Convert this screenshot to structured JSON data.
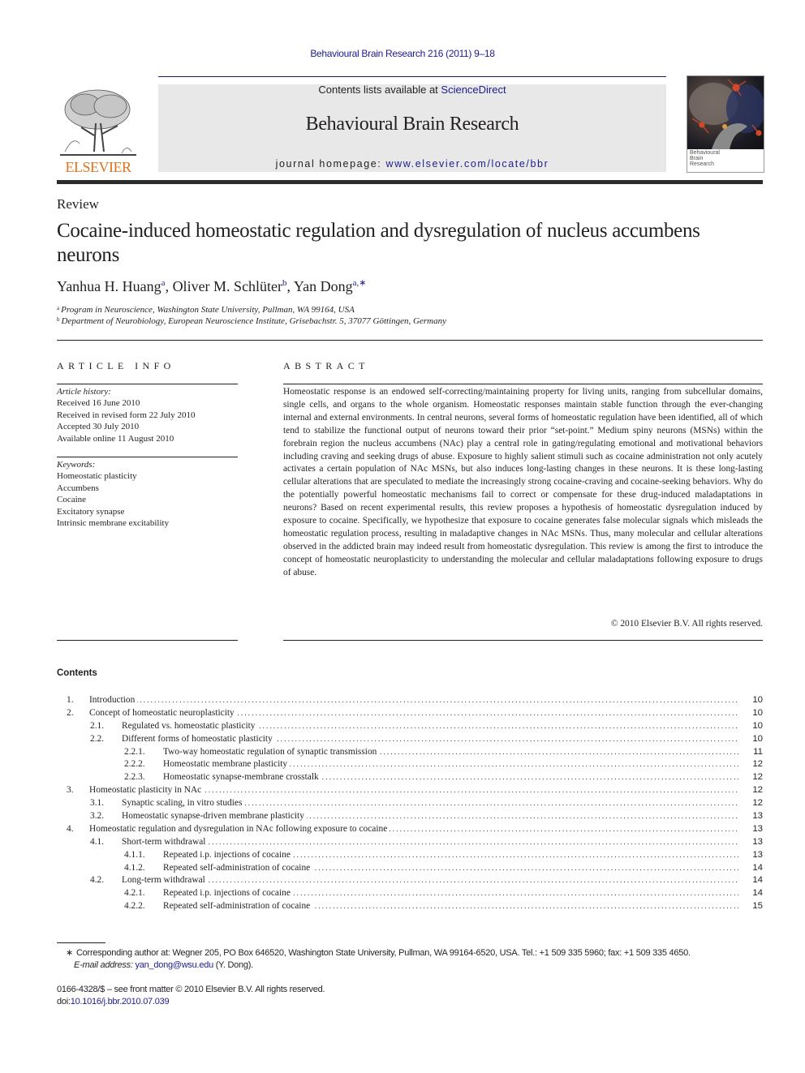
{
  "header": {
    "journal_citation": "Behavioural Brain Research 216 (2011) 9–18",
    "contents_prefix": "Contents lists available at ",
    "contents_link": "ScienceDirect",
    "journal_name": "Behavioural Brain Research",
    "homepage_prefix": "journal homepage: ",
    "homepage_link": "www.elsevier.com/locate/bbr",
    "publisher_logo_text": "ELSEVIER",
    "cover_title_lines": [
      "Behavioural",
      "Brain",
      "Research"
    ],
    "colors": {
      "link": "#1c1c8e",
      "elsevier_orange": "#e1711f",
      "masthead_gray": "#e8e8e8"
    }
  },
  "article": {
    "type": "Review",
    "title": "Cocaine-induced homeostatic regulation and dysregulation of nucleus accumbens neurons",
    "authors": [
      {
        "name": "Yanhua H. Huang",
        "marks": "a"
      },
      {
        "name": "Oliver M. Schlüter",
        "marks": "b"
      },
      {
        "name": "Yan Dong",
        "marks": "a,∗"
      }
    ],
    "affiliations": [
      {
        "mark": "a",
        "text": "Program in Neuroscience, Washington State University, Pullman, WA 99164, USA"
      },
      {
        "mark": "b",
        "text": "Department of Neurobiology, European Neuroscience Institute, Grisebachstr. 5, 37077 Göttingen, Germany"
      }
    ]
  },
  "article_info": {
    "heading": "ARTICLE INFO",
    "history_label": "Article history:",
    "history": [
      "Received 16 June 2010",
      "Received in revised form 22 July 2010",
      "Accepted 30 July 2010",
      "Available online 11 August 2010"
    ],
    "keywords_label": "Keywords:",
    "keywords": [
      "Homeostatic plasticity",
      "Accumbens",
      "Cocaine",
      "Excitatory synapse",
      "Intrinsic membrane excitability"
    ]
  },
  "abstract": {
    "heading": "ABSTRACT",
    "text": "Homeostatic response is an endowed self-correcting/maintaining property for living units, ranging from subcellular domains, single cells, and organs to the whole organism. Homeostatic responses maintain sta­ble function through the ever-changing internal and external environments. In central neurons, several forms of homeostatic regulation have been identified, all of which tend to stabilize the functional output of neurons toward their prior “set-point.” Medium spiny neurons (MSNs) within the forebrain region the nucleus accumbens (NAc) play a central role in gating/regulating emotional and motivational behaviors including craving and seeking drugs of abuse. Exposure to highly salient stimuli such as cocaine adminis­tration not only acutely activates a certain population of NAc MSNs, but also induces long-lasting changes in these neurons. It is these long-lasting cellular alterations that are speculated to mediate the increasingly strong cocaine-craving and cocaine-seeking behaviors. Why do the potentially powerful homeostatic mechanisms fail to correct or compensate for these drug-induced maladaptations in neurons? Based on recent experimental results, this review proposes a hypothesis of homeostatic dysregulation induced by exposure to cocaine. Specifically, we hypothesize that exposure to cocaine generates false molecu­lar signals which misleads the homeostatic regulation process, resulting in maladaptive changes in NAc MSNs. Thus, many molecular and cellular alterations observed in the addicted brain may indeed result from homeostatic dysregulation. This review is among the first to introduce the concept of homeostatic neuroplasticity to understanding the molecular and cellular maladaptations following exposure to drugs of abuse.",
    "copyright": "© 2010 Elsevier B.V. All rights reserved."
  },
  "contents": {
    "heading": "Contents",
    "entries": [
      {
        "level": 1,
        "num": "1.",
        "title": "Introduction",
        "page": "10"
      },
      {
        "level": 1,
        "num": "2.",
        "title": "Concept of homeostatic neuroplasticity",
        "page": "10"
      },
      {
        "level": 2,
        "num": "2.1.",
        "title": "Regulated vs. homeostatic plasticity",
        "page": "10"
      },
      {
        "level": 2,
        "num": "2.2.",
        "title": "Different forms of homeostatic plasticity",
        "page": "10"
      },
      {
        "level": 3,
        "num": "2.2.1.",
        "title": "Two-way homeostatic regulation of synaptic transmission",
        "page": "11"
      },
      {
        "level": 3,
        "num": "2.2.2.",
        "title": "Homeostatic membrane plasticity",
        "page": "12"
      },
      {
        "level": 3,
        "num": "2.2.3.",
        "title": "Homeostatic synapse-membrane crosstalk",
        "page": "12"
      },
      {
        "level": 1,
        "num": "3.",
        "title": "Homeostatic plasticity in NAc",
        "page": "12"
      },
      {
        "level": 2,
        "num": "3.1.",
        "title": "Synaptic scaling, in vitro studies",
        "page": "12"
      },
      {
        "level": 2,
        "num": "3.2.",
        "title": "Homeostatic synapse-driven membrane plasticity",
        "page": "13"
      },
      {
        "level": 1,
        "num": "4.",
        "title": "Homeostatic regulation and dysregulation in NAc following exposure to cocaine",
        "page": "13"
      },
      {
        "level": 2,
        "num": "4.1.",
        "title": "Short-term withdrawal",
        "page": "13"
      },
      {
        "level": 3,
        "num": "4.1.1.",
        "title": "Repeated i.p. injections of cocaine",
        "page": "13"
      },
      {
        "level": 3,
        "num": "4.1.2.",
        "title": "Repeated self-administration of cocaine",
        "page": "14"
      },
      {
        "level": 2,
        "num": "4.2.",
        "title": "Long-term withdrawal",
        "page": "14"
      },
      {
        "level": 3,
        "num": "4.2.1.",
        "title": "Repeated i.p. injections of cocaine",
        "page": "14"
      },
      {
        "level": 3,
        "num": "4.2.2.",
        "title": "Repeated self-administration of cocaine",
        "page": "15"
      }
    ]
  },
  "footnotes": {
    "corresponding_mark": "∗",
    "corresponding": "Corresponding author at: Wegner 205, PO Box 646520, Washington State University, Pullman, WA 99164-6520, USA. Tel.: +1 509 335 5960; fax: +1 509 335 4650.",
    "email_label": "E-mail address:",
    "email": "yan_dong@wsu.edu",
    "email_suffix": " (Y. Dong).",
    "issn_line": "0166-4328/$ – see front matter © 2010 Elsevier B.V. All rights reserved.",
    "doi_prefix": "doi:",
    "doi": "10.1016/j.bbr.2010.07.039"
  }
}
